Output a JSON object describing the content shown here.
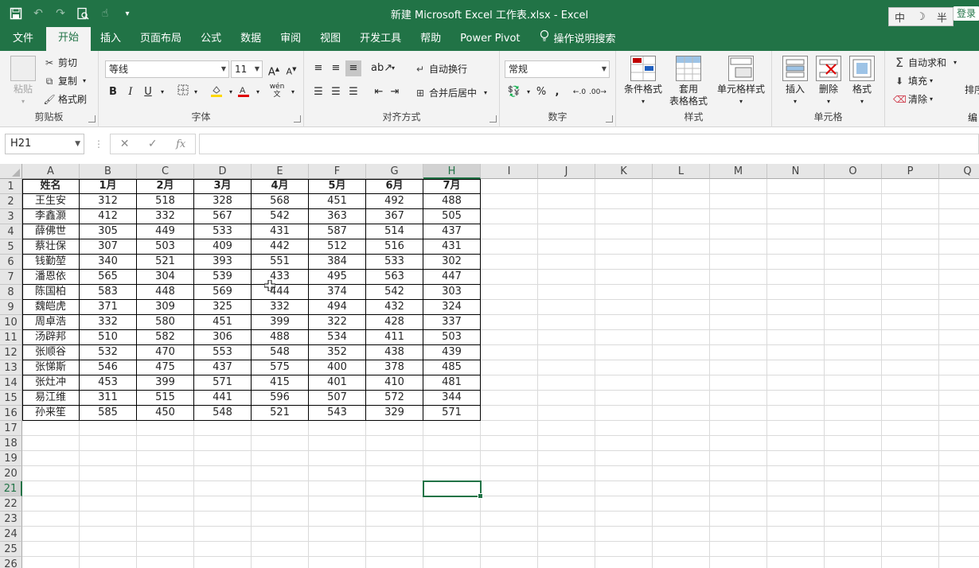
{
  "window": {
    "title": "新建 Microsoft Excel 工作表.xlsx  -  Excel",
    "login_label": "登录",
    "ime": [
      "中",
      "☽",
      "半"
    ]
  },
  "tabs": [
    {
      "label": "文件",
      "name": "tab-file"
    },
    {
      "label": "开始",
      "name": "tab-home",
      "active": true
    },
    {
      "label": "插入",
      "name": "tab-insert"
    },
    {
      "label": "页面布局",
      "name": "tab-page-layout"
    },
    {
      "label": "公式",
      "name": "tab-formulas"
    },
    {
      "label": "数据",
      "name": "tab-data"
    },
    {
      "label": "审阅",
      "name": "tab-review"
    },
    {
      "label": "视图",
      "name": "tab-view"
    },
    {
      "label": "开发工具",
      "name": "tab-developer"
    },
    {
      "label": "帮助",
      "name": "tab-help"
    },
    {
      "label": "Power Pivot",
      "name": "tab-power-pivot"
    },
    {
      "label": "操作说明搜索",
      "name": "tell-me-search"
    }
  ],
  "ribbon": {
    "clipboard": {
      "label": "剪贴板",
      "paste": "粘贴",
      "cut": "剪切",
      "copy": "复制",
      "format_painter": "格式刷"
    },
    "font": {
      "label": "字体",
      "font_name": "等线",
      "font_size": "11",
      "bold": "B",
      "italic": "I",
      "underline": "U",
      "wen": "wén"
    },
    "alignment": {
      "label": "对齐方式",
      "wrap_text": "自动换行",
      "merge_center": "合并后居中"
    },
    "number": {
      "label": "数字",
      "format": "常规",
      "percent": "%",
      "comma": ","
    },
    "styles": {
      "label": "样式",
      "conditional": "条件格式",
      "table_format_1": "套用",
      "table_format_2": "表格格式",
      "cell_styles": "单元格样式"
    },
    "cells": {
      "label": "单元格",
      "insert": "插入",
      "delete": "删除",
      "format": "格式"
    },
    "editing": {
      "label": "编",
      "autosum": "自动求和",
      "fill": "填充",
      "clear": "清除",
      "sort": "排序"
    }
  },
  "formula_bar": {
    "name_box": "H21",
    "fx": "fx",
    "value": ""
  },
  "sheet": {
    "columns": [
      "A",
      "B",
      "C",
      "D",
      "E",
      "F",
      "G",
      "H",
      "I",
      "J",
      "K",
      "L",
      "M",
      "N",
      "O",
      "P",
      "Q"
    ],
    "selected_column": "H",
    "selected_row": 21,
    "rows": [
      [
        "姓名",
        "1月",
        "2月",
        "3月",
        "4月",
        "5月",
        "6月",
        "7月"
      ],
      [
        "王生安",
        "312",
        "518",
        "328",
        "568",
        "451",
        "492",
        "488"
      ],
      [
        "李鑫灏",
        "412",
        "332",
        "567",
        "542",
        "363",
        "367",
        "505"
      ],
      [
        "薛佛世",
        "305",
        "449",
        "533",
        "431",
        "587",
        "514",
        "437"
      ],
      [
        "蔡壮保",
        "307",
        "503",
        "409",
        "442",
        "512",
        "516",
        "431"
      ],
      [
        "钱勤堃",
        "340",
        "521",
        "393",
        "551",
        "384",
        "533",
        "302"
      ],
      [
        "潘恩依",
        "565",
        "304",
        "539",
        "433",
        "495",
        "563",
        "447"
      ],
      [
        "陈国柏",
        "583",
        "448",
        "569",
        "444",
        "374",
        "542",
        "303"
      ],
      [
        "魏皑虎",
        "371",
        "309",
        "325",
        "332",
        "494",
        "432",
        "324"
      ],
      [
        "周卓浩",
        "332",
        "580",
        "451",
        "399",
        "322",
        "428",
        "337"
      ],
      [
        "汤辟邦",
        "510",
        "582",
        "306",
        "488",
        "534",
        "411",
        "503"
      ],
      [
        "张顺谷",
        "532",
        "470",
        "553",
        "548",
        "352",
        "438",
        "439"
      ],
      [
        "张悌斯",
        "546",
        "475",
        "437",
        "575",
        "400",
        "378",
        "485"
      ],
      [
        "张灶冲",
        "453",
        "399",
        "571",
        "415",
        "401",
        "410",
        "481"
      ],
      [
        "易江维",
        "311",
        "515",
        "441",
        "596",
        "507",
        "572",
        "344"
      ],
      [
        "孙来笙",
        "585",
        "450",
        "548",
        "521",
        "543",
        "329",
        "571"
      ]
    ],
    "row_count": 26
  }
}
